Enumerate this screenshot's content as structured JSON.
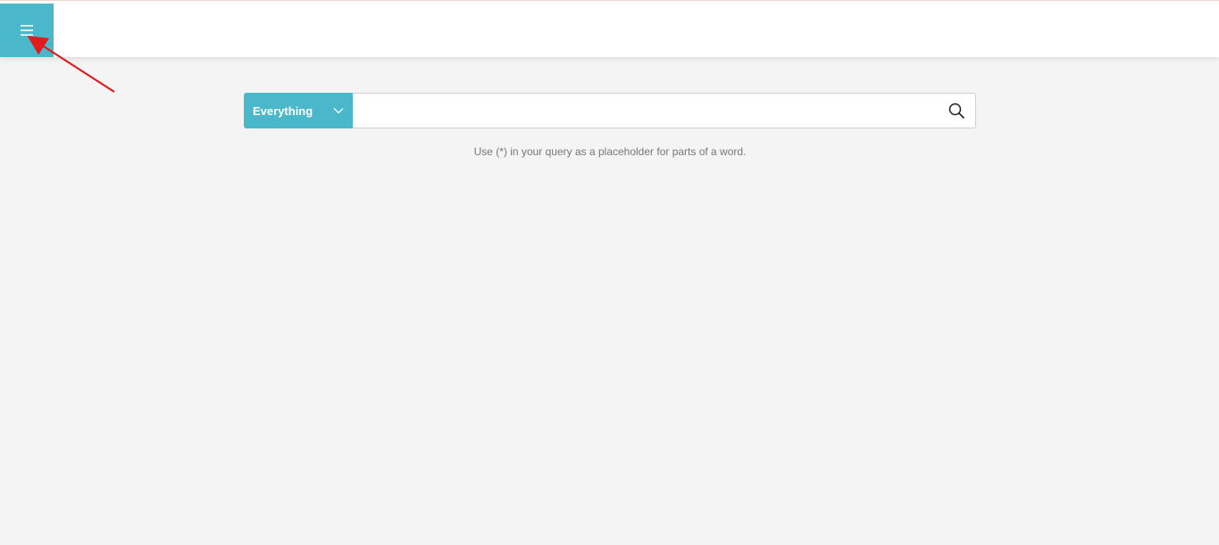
{
  "header": {
    "menu_icon": "hamburger-menu-icon"
  },
  "search": {
    "scope_label": "Everything",
    "scope_icon": "chevron-down-icon",
    "value": "",
    "placeholder": "",
    "button_icon": "search-icon",
    "hint": "Use (*) in your query as a placeholder for parts of a word."
  },
  "colors": {
    "accent": "#4bb7cb",
    "background": "#f4f4f4",
    "annotation_arrow": "#e01b1b"
  }
}
